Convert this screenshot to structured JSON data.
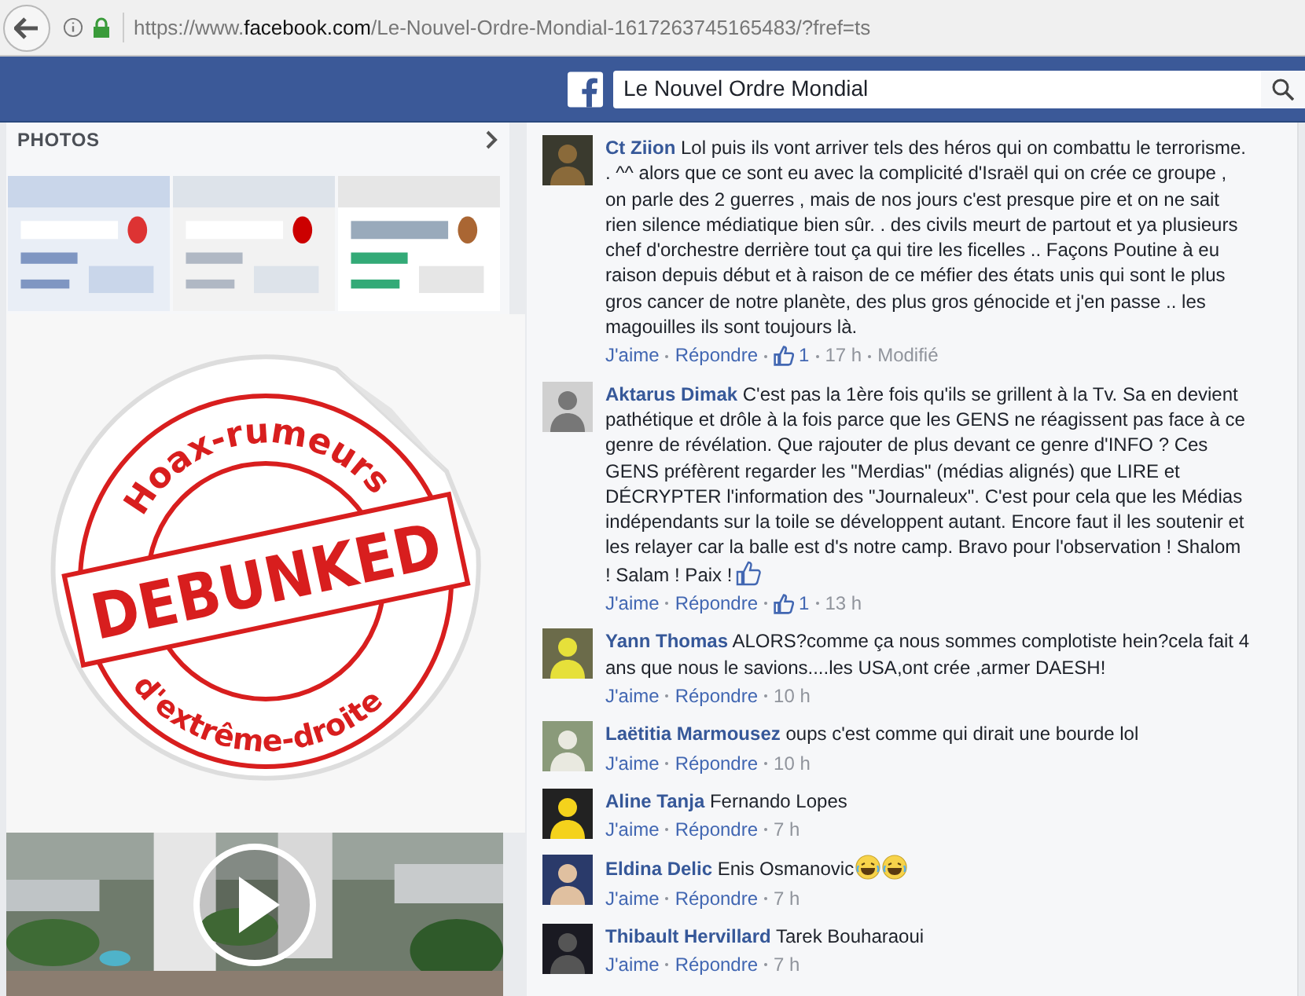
{
  "browser": {
    "url_prefix": "https://www.",
    "url_domain": "facebook.com",
    "url_path": "/Le-Nouvel-Ordre-Mondial-1617263745165483/?fref=ts"
  },
  "topbar": {
    "search_value": "Le Nouvel Ordre Mondial"
  },
  "photos": {
    "title": "PHOTOS"
  },
  "sticker": {
    "top_text": "Hoax-rumeurs",
    "center_text": "DEBUNKED",
    "bottom_text": "d'extrême-droite"
  },
  "comments": [
    {
      "author": "Ct Ziion",
      "text": "Lol puis ils vont arriver tels des héros qui on combattu le terrorisme. . ^^ alors que ce sont eu avec la complicité d'Israël qui on crée ce groupe , on parle des 2 guerres , mais de nos jours c'est presque pire et on ne sait rien silence médiatique bien sûr. . des civils meurt de partout et ya plusieurs chef d'orchestre derrière tout ça qui tire les ficelles .. Façons Poutine à eu raison depuis début et à raison de ce méfier des états unis qui sont le plus gros cancer de notre planète, des plus gros génocide et j'en passe .. les magouilles ils sont toujours là.",
      "like": "J'aime",
      "reply": "Répondre",
      "likes": "1",
      "time": "17 h",
      "edited": "Modifié"
    },
    {
      "author": "Aktarus Dimak",
      "text": "C'est pas la 1ère fois qu'ils se grillent à la Tv. Sa en devient pathétique et drôle à la fois parce que les GENS ne réagissent pas face à ce genre de révélation. Que rajouter de plus devant ce genre d'INFO ? Ces GENS préfèrent regarder les \"Merdias\" (médias alignés) que LIRE et DÉCRYPTER l'information des \"Journaleux\". C'est pour cela que les Médias indépendants sur la toile se développent autant. Encore faut il les soutenir et les relayer car la balle est d's notre camp. Bravo pour l'observation ! Shalom ! Salam ! Paix !",
      "emoji": [
        {
          "kind": "thumb"
        }
      ],
      "like": "J'aime",
      "reply": "Répondre",
      "likes": "1",
      "time": "13 h"
    },
    {
      "author": "Yann Thomas",
      "text": "ALORS?comme ça nous sommes complotiste hein?cela fait 4 ans que nous le savions....les USA,ont crée ,armer DAESH!",
      "like": "J'aime",
      "reply": "Répondre",
      "time": "10 h"
    },
    {
      "author": "Laëtitia Marmousez",
      "text": "oups c'est comme qui dirait une bourde lol",
      "like": "J'aime",
      "reply": "Répondre",
      "time": "10 h"
    },
    {
      "author": "Aline Tanja",
      "text": "Fernando Lopes",
      "like": "J'aime",
      "reply": "Répondre",
      "time": "7 h"
    },
    {
      "author": "Eldina Delic",
      "text": "Enis Osmanovic",
      "emoji": [
        {
          "kind": "laugh"
        },
        {
          "kind": "laugh"
        }
      ],
      "like": "J'aime",
      "reply": "Répondre",
      "time": "7 h"
    },
    {
      "author": "Thibault Hervillard",
      "text": "Tarek Bouharaoui",
      "like": "J'aime",
      "reply": "Répondre",
      "time": "7 h"
    }
  ]
}
